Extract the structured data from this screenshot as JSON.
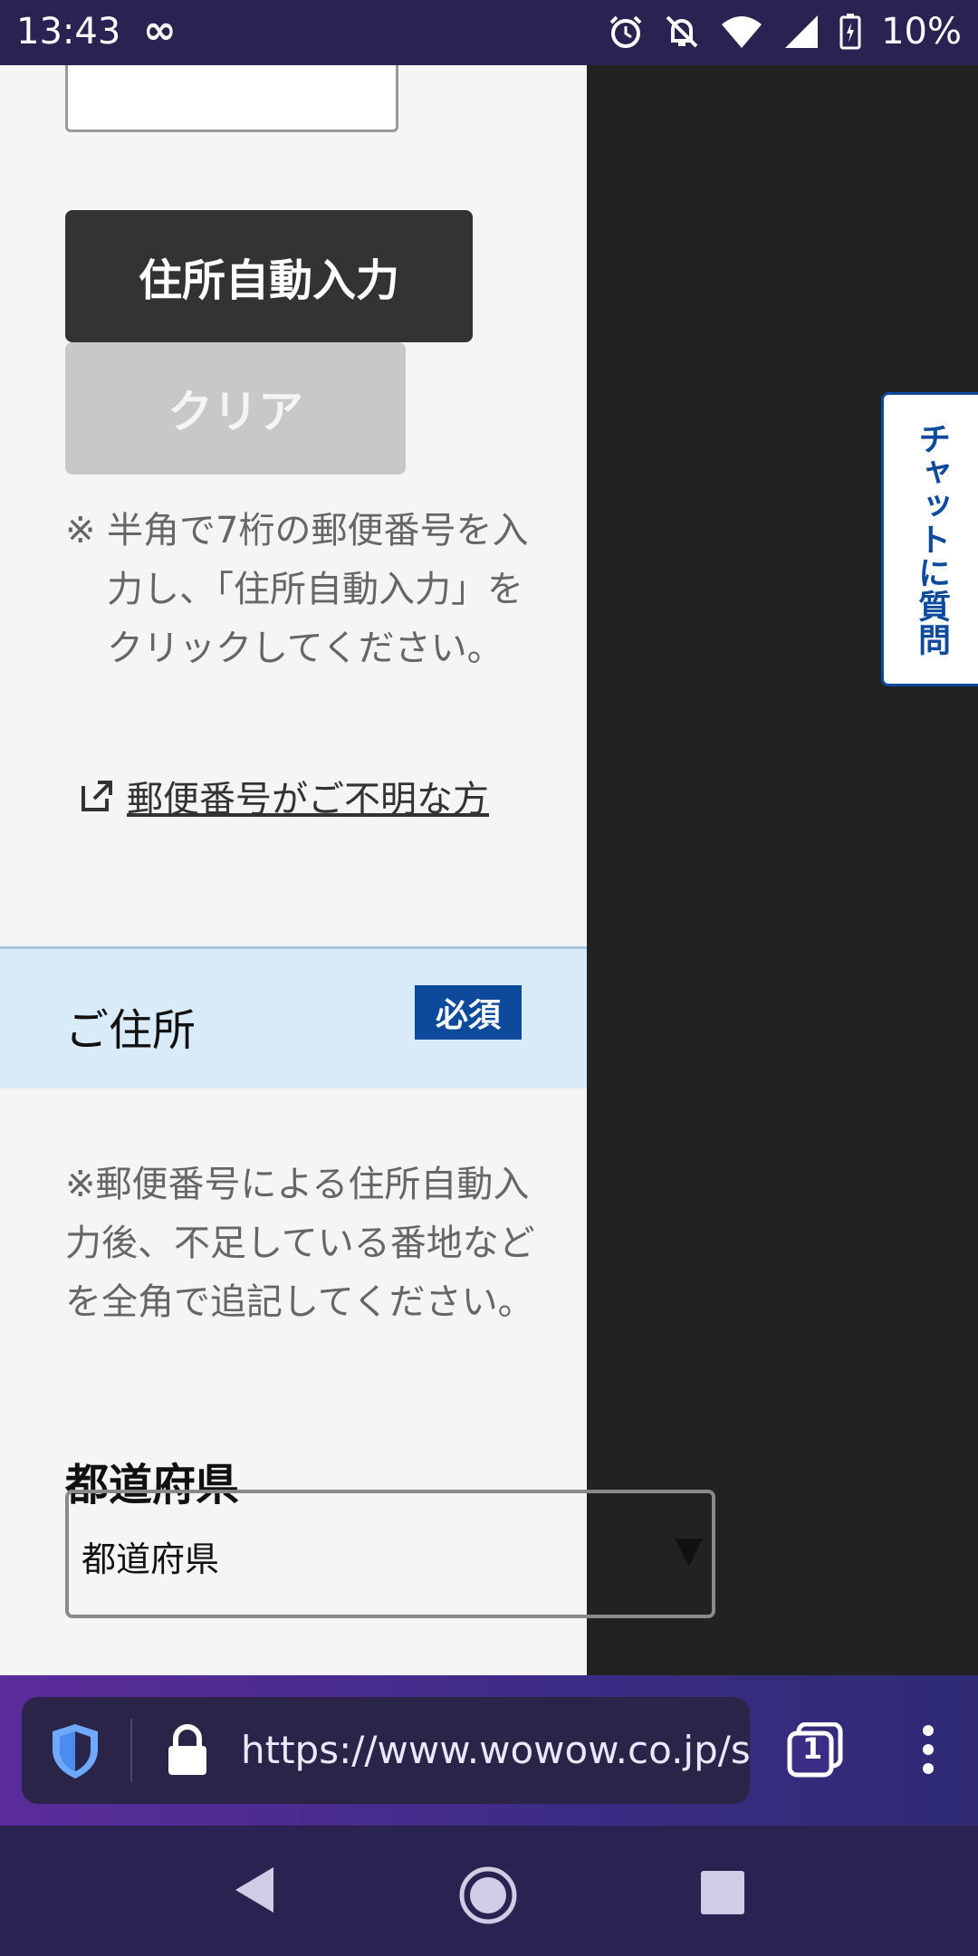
{
  "status_bar": {
    "time": "13:43",
    "battery": "10%"
  },
  "form": {
    "auto_fill_button": "住所自動入力",
    "clear_button": "クリア",
    "postal_note_mark": "※",
    "postal_note_body": "半角で7桁の郵便番号を入力し、「住所自動入力」をクリックしてください。",
    "postal_link": "郵便番号がご不明な方",
    "section_title": "ご住所",
    "required_badge": "必須",
    "address_note": "※郵便番号による住所自動入力後、不足している番地などを全角で追記してください。",
    "prefecture_label": "都道府県",
    "prefecture_select_value": "都道府県",
    "select_arrow": "▼"
  },
  "chat_tab_label": "チャットに質問",
  "browser": {
    "url": "https://www.wowow.co.jp/s",
    "tab_count": "1"
  },
  "colors": {
    "accent_blue": "#0d4a9c",
    "section_bg": "#d9ebf8",
    "dark_button": "#333333",
    "disabled_button": "#c8c8c8"
  }
}
